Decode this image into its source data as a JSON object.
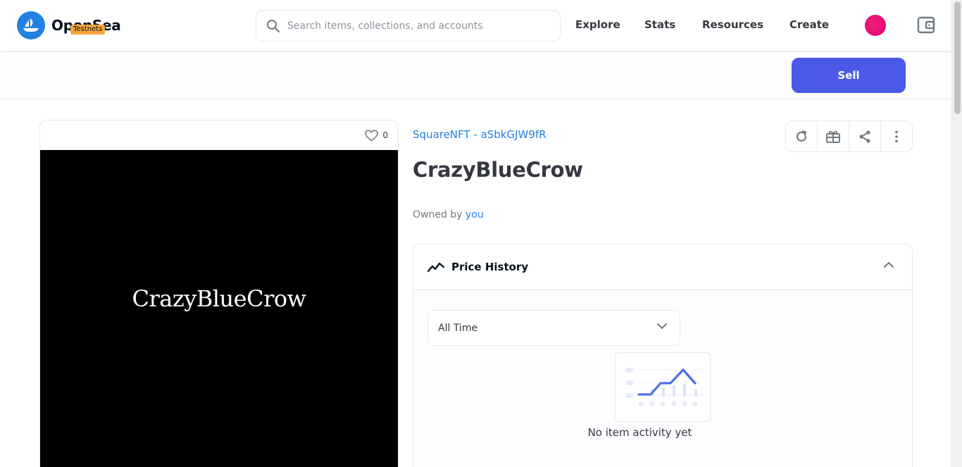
{
  "header": {
    "logo_text": "OpenSea",
    "badge": "Testnets",
    "search_placeholder": "Search items, collections, and accounts",
    "nav": [
      "Explore",
      "Stats",
      "Resources",
      "Create"
    ]
  },
  "sell_bar": {
    "sell_label": "Sell"
  },
  "media": {
    "favorite_count": "0",
    "image_text": "CrazyBlueCrow"
  },
  "item": {
    "collection": "SquareNFT - aSbkGJW9fR",
    "title": "CrazyBlueCrow",
    "owned_by_label": "Owned by",
    "owner": "you"
  },
  "price_history": {
    "title": "Price History",
    "time_filter": "All Time",
    "empty_message": "No item activity yet"
  },
  "colors": {
    "primary_button": "#4a59e6",
    "link": "#2081e2",
    "badge": "#f4a43b",
    "avatar": "#e0006e"
  }
}
